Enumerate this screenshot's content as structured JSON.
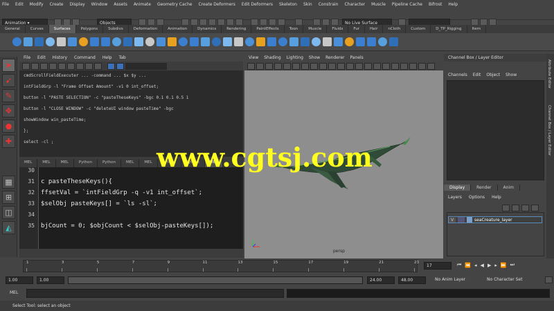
{
  "menubar": [
    "File",
    "Edit",
    "Modify",
    "Create",
    "Display",
    "Window",
    "Assets",
    "Animate",
    "Geometry Cache",
    "Create Deformers",
    "Edit Deformers",
    "Skeleton",
    "Skin",
    "Constrain",
    "Character",
    "Muscle",
    "Pipeline Cache",
    "Bifrost",
    "Help"
  ],
  "statusline": {
    "mode": "Animation",
    "objects_label": "Objects",
    "live_surface": "No Live Surface"
  },
  "shelf_tabs": [
    "General",
    "Curves",
    "Surfaces",
    "Polygons",
    "Subdivs",
    "Deformation",
    "Animation",
    "Dynamics",
    "Rendering",
    "PaintEffects",
    "Toon",
    "Muscle",
    "Fluids",
    "Fur",
    "Hair",
    "nCloth",
    "Custom",
    "D_TP_Rigging",
    "Item"
  ],
  "shelf_active": 2,
  "script_editor": {
    "menu": [
      "File",
      "Edit",
      "History",
      "Command",
      "Help",
      "Tab"
    ],
    "history": [
      "cmdScrollFieldExecuter ... -command ... $x $y ...",
      "intFieldGrp -l \"Frame Offset Amount\" -v1 0 int_offset;",
      "button -l \"PASTE SELECTION\" -c \"pasteTheseKeys\" -bgc 0.1 0.1 0.5 1",
      "button -l \"CLOSE WINDOW\" -c \"deleteUI window pasteTime\" -bgc",
      "showWindow win_pasteTime;",
      "};",
      "select -cl ;"
    ],
    "tabs": [
      "MEL",
      "MEL",
      "MEL",
      "Python",
      "Python",
      "MEL",
      "MEL",
      "Python",
      "Python",
      "MEL"
    ],
    "active_tab": 9,
    "line_numbers": [
      "30",
      "31",
      "32",
      "33",
      "34",
      "35"
    ],
    "code": [
      "",
      "c pasteTheseKeys(){",
      "ffsetVal = `intFieldGrp -q -v1 int_offset`;",
      "$selObj pasteKeys[] = `ls -sl`;",
      "",
      "bjCount = 0; $objCount < $selObj-pasteKeys[]);"
    ]
  },
  "viewport": {
    "menu": [
      "View",
      "Shading",
      "Lighting",
      "Show",
      "Renderer",
      "Panels"
    ],
    "camera_label": "persp"
  },
  "outliner": {
    "title": "Channel Box / Layer Editor",
    "menu": [
      "Channels",
      "Edit",
      "Object",
      "Show"
    ]
  },
  "layers": {
    "tabs": [
      "Display",
      "Render",
      "Anim"
    ],
    "active_tab": 0,
    "menu": [
      "Layers",
      "Options",
      "Help"
    ],
    "layer_flag": "V",
    "layer_name": "seaCreature_layer"
  },
  "side_tabs": [
    "Attribute Editor",
    "Channel Box / Layer Editor"
  ],
  "timeline": {
    "ticks": [
      "1",
      "3",
      "5",
      "7",
      "9",
      "11",
      "13",
      "15",
      "17",
      "19",
      "21",
      "23"
    ],
    "current_frame": "17"
  },
  "range": {
    "start": "1.00",
    "start_inner": "1.00",
    "end_inner": "24.00",
    "end": "48.00",
    "anim_layer": "No Anim Layer",
    "char_set": "No Character Set"
  },
  "command": {
    "label": "MEL"
  },
  "help_text": "Select Tool: select an object",
  "watermark": "www.cgtsj.com",
  "colors": {
    "red_tool": "#e33333",
    "shelf_icons": [
      "#3a7fd0",
      "#57a0e0",
      "#2f6fb8",
      "#7db8ee",
      "#c8c8c8",
      "#4a90d9",
      "#e8a020",
      "#3a7fd0"
    ]
  }
}
